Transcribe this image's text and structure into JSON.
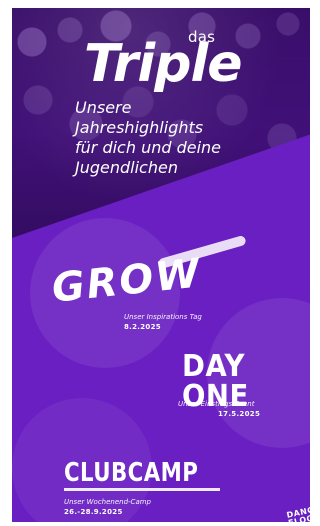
{
  "colors": {
    "background_outer": "#ffffff",
    "brand_purple": "#6a1fc2",
    "hero_purple": "#4a138a",
    "text": "#ffffff"
  },
  "hero": {
    "prefix": "das",
    "title": "Triple",
    "intro_lines": [
      "Unsere",
      "Jahreshighlights",
      "für dich und deine",
      "Jugendlichen"
    ]
  },
  "events": [
    {
      "name": "GROW",
      "subtitle": "Unser Inspirations Tag",
      "date": "8.2.2025"
    },
    {
      "name": "DAY ONE",
      "subtitle": "Unser Einstiegs Event",
      "date": "17.5.2025"
    },
    {
      "name": "CLUBCAMP",
      "subtitle": "Unser Wochenend-Camp",
      "date": "26.-28.9.2025"
    }
  ],
  "footer_logo": {
    "lines": [
      "DANCE",
      "FLOOR"
    ]
  }
}
